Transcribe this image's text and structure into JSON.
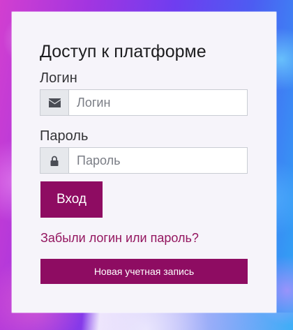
{
  "form": {
    "title": "Доступ к платформе",
    "login_label": "Логин",
    "login_placeholder": "Логин",
    "login_value": "",
    "login_icon": "envelope-icon",
    "password_label": "Пароль",
    "password_placeholder": "Пароль",
    "password_value": "",
    "password_icon": "lock-icon",
    "submit_label": "Вход",
    "forgot_link": "Забыли логин или пароль?",
    "register_label": "Новая учетная запись"
  },
  "colors": {
    "accent": "#8e0c62",
    "link": "#93155f",
    "card_background": "#f6f4fa",
    "addon_background": "#e6e8ec",
    "icon": "#4a4d55"
  }
}
